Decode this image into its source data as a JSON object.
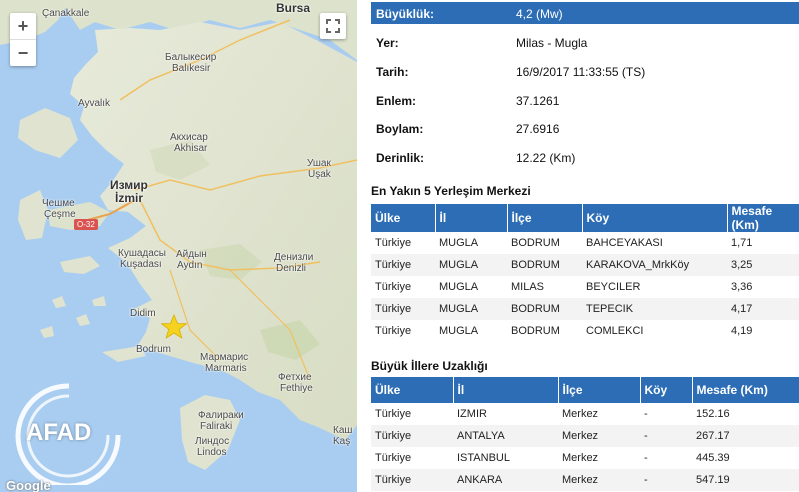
{
  "map": {
    "zoom_in": "+",
    "zoom_out": "−",
    "logo_text": "AFAD",
    "google_text": "Google",
    "route_label": "O-32",
    "labels": [
      {
        "text": "Çanakkale",
        "cls": "",
        "name": "map-label-canakkale"
      },
      {
        "text": "Bursa",
        "cls": "big",
        "name": "map-label-bursa"
      },
      {
        "text": "Балыкесир",
        "cls": "",
        "name": "map-label-balikesir-cyr"
      },
      {
        "text": "Balıkesir",
        "cls": "",
        "name": "map-label-balikesir"
      },
      {
        "text": "Ayvalık",
        "cls": "",
        "name": "map-label-ayvalik"
      },
      {
        "text": "Акхисар",
        "cls": "",
        "name": "map-label-akhisar-cyr"
      },
      {
        "text": "Akhisar",
        "cls": "",
        "name": "map-label-akhisar"
      },
      {
        "text": "Ушак",
        "cls": "",
        "name": "map-label-usak-cyr"
      },
      {
        "text": "Uşak",
        "cls": "",
        "name": "map-label-usak"
      },
      {
        "text": "Измир",
        "cls": "big",
        "name": "map-label-izmir-cyr"
      },
      {
        "text": "İzmir",
        "cls": "big",
        "name": "map-label-izmir"
      },
      {
        "text": "Чешме",
        "cls": "",
        "name": "map-label-cesme-cyr"
      },
      {
        "text": "Çeşme",
        "cls": "",
        "name": "map-label-cesme"
      },
      {
        "text": "Кушадасы",
        "cls": "",
        "name": "map-label-kusadasi-cyr"
      },
      {
        "text": "Kuşadası",
        "cls": "",
        "name": "map-label-kusadasi"
      },
      {
        "text": "Айдын",
        "cls": "",
        "name": "map-label-aydin-cyr"
      },
      {
        "text": "Aydın",
        "cls": "",
        "name": "map-label-aydin"
      },
      {
        "text": "Денизли",
        "cls": "",
        "name": "map-label-denizli-cyr"
      },
      {
        "text": "Denizli",
        "cls": "",
        "name": "map-label-denizli"
      },
      {
        "text": "Didim",
        "cls": "",
        "name": "map-label-didim"
      },
      {
        "text": "Bodrum",
        "cls": "",
        "name": "map-label-bodrum"
      },
      {
        "text": "Мармарис",
        "cls": "",
        "name": "map-label-marmaris-cyr"
      },
      {
        "text": "Marmaris",
        "cls": "",
        "name": "map-label-marmaris"
      },
      {
        "text": "Фетхие",
        "cls": "",
        "name": "map-label-fethiye-cyr"
      },
      {
        "text": "Fethiye",
        "cls": "",
        "name": "map-label-fethiye"
      },
      {
        "text": "Фалираки",
        "cls": "",
        "name": "map-label-faliraki-cyr"
      },
      {
        "text": "Faliraki",
        "cls": "",
        "name": "map-label-faliraki"
      },
      {
        "text": "Линдос",
        "cls": "",
        "name": "map-label-lindos-cyr"
      },
      {
        "text": "Lindos",
        "cls": "",
        "name": "map-label-lindos"
      },
      {
        "text": "Каш",
        "cls": "",
        "name": "map-label-kas-cyr"
      },
      {
        "text": "Kaş",
        "cls": "",
        "name": "map-label-kas"
      }
    ]
  },
  "event": [
    {
      "key": "Büyüklük:",
      "value": "4,2 (Mw)"
    },
    {
      "key": "Yer:",
      "value": "Milas - Mugla"
    },
    {
      "key": "Tarih:",
      "value": "16/9/2017 11:33:55 (TS)"
    },
    {
      "key": "Enlem:",
      "value": "37.1261"
    },
    {
      "key": "Boylam:",
      "value": "27.6916"
    },
    {
      "key": "Derinlik:",
      "value": "12.22 (Km)"
    }
  ],
  "nearest": {
    "title": "En Yakın 5 Yerleşim Merkezi",
    "headers": [
      "Ülke",
      "İl",
      "İlçe",
      "Köy",
      "Mesafe (Km)"
    ],
    "rows": [
      [
        "Türkiye",
        "MUGLA",
        "BODRUM",
        "BAHCEYAKASI",
        "1,71"
      ],
      [
        "Türkiye",
        "MUGLA",
        "BODRUM",
        "KARAKOVA_MrkKöy",
        "3,25"
      ],
      [
        "Türkiye",
        "MUGLA",
        "MILAS",
        "BEYCILER",
        "3,36"
      ],
      [
        "Türkiye",
        "MUGLA",
        "BODRUM",
        "TEPECIK",
        "4,17"
      ],
      [
        "Türkiye",
        "MUGLA",
        "BODRUM",
        "COMLEKCI",
        "4,19"
      ]
    ]
  },
  "cities": {
    "title": "Büyük İllere Uzaklığı",
    "headers": [
      "Ülke",
      "İl",
      "İlçe",
      "Köy",
      "Mesafe (Km)"
    ],
    "rows": [
      [
        "Türkiye",
        "IZMIR",
        "Merkez",
        "-",
        "152.16"
      ],
      [
        "Türkiye",
        "ANTALYA",
        "Merkez",
        "-",
        "267.17"
      ],
      [
        "Türkiye",
        "ISTANBUL",
        "Merkez",
        "-",
        "445.39"
      ],
      [
        "Türkiye",
        "ANKARA",
        "Merkez",
        "-",
        "547.19"
      ]
    ]
  },
  "colors": {
    "header_blue": "#2c6db5",
    "epicenter_star": "#f4d21f"
  }
}
